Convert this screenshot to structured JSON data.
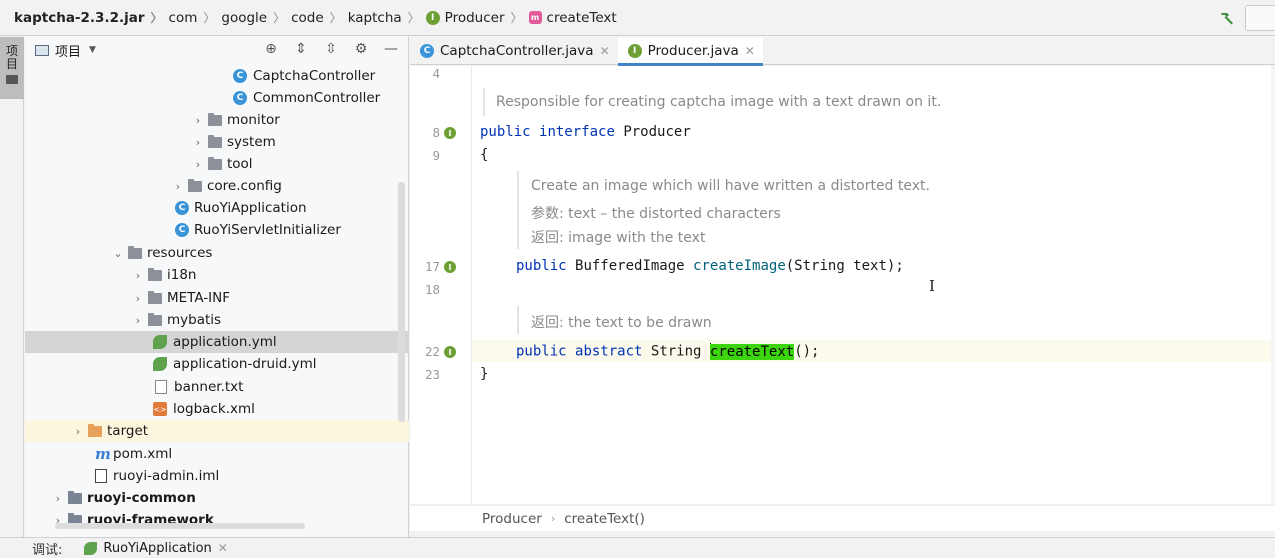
{
  "navbar": {
    "crumbs": [
      "kaptcha-2.3.2.jar",
      "com",
      "google",
      "code",
      "kaptcha",
      "Producer",
      "createText"
    ],
    "interface_badge": "I",
    "method_badge": "m"
  },
  "sidebar": {
    "project_tab_label": "项目"
  },
  "project": {
    "title": "项目",
    "tree": [
      {
        "label": "CaptchaController",
        "type": "class-icon"
      },
      {
        "label": "CommonController",
        "type": "class-icon"
      },
      {
        "label": "monitor",
        "type": "folder-icon"
      },
      {
        "label": "system",
        "type": "folder-icon"
      },
      {
        "label": "tool",
        "type": "folder-icon"
      },
      {
        "label": "core.config",
        "type": "folder-icon"
      },
      {
        "label": "RuoYiApplication",
        "type": "spring-class-icon"
      },
      {
        "label": "RuoYiServletInitializer",
        "type": "class-icon"
      },
      {
        "label": "resources",
        "type": "resources-folder-icon"
      },
      {
        "label": "i18n",
        "type": "folder-icon"
      },
      {
        "label": "META-INF",
        "type": "folder-icon"
      },
      {
        "label": "mybatis",
        "type": "folder-icon"
      },
      {
        "label": "application.yml",
        "type": "spring-leaf-icon"
      },
      {
        "label": "application-druid.yml",
        "type": "spring-leaf-icon"
      },
      {
        "label": "banner.txt",
        "type": "text-file-icon"
      },
      {
        "label": "logback.xml",
        "type": "xml-file-icon"
      },
      {
        "label": "target",
        "type": "excluded-folder-icon"
      },
      {
        "label": "pom.xml",
        "type": "maven-icon"
      },
      {
        "label": "ruoyi-admin.iml",
        "type": "iml-file-icon"
      },
      {
        "label": "ruoyi-common",
        "type": "module-folder-icon"
      },
      {
        "label": "ruoyi-framework",
        "type": "module-folder-icon"
      }
    ]
  },
  "tabs": [
    {
      "label": "CaptchaController.java",
      "badge": "C",
      "active": false
    },
    {
      "label": "Producer.java",
      "badge": "I",
      "active": true
    }
  ],
  "editor": {
    "line_numbers": [
      "4",
      "8",
      "9",
      "17",
      "18",
      "22",
      "23"
    ],
    "doc1": "Responsible for creating captcha image with a text drawn on it.",
    "line8_kw1": "public",
    "line8_kw2": "interface",
    "line8_name": "Producer",
    "line9": "{",
    "doc2_line1": "Create an image which will have written a distorted text.",
    "doc2_param_label": "参数:",
    "doc2_param_text": "text – the distorted characters",
    "doc2_return_label": "返回:",
    "doc2_return_text": "image with the text",
    "line17_kw": "public",
    "line17_type": "BufferedImage",
    "line17_method": "createImage",
    "line17_args": "(String text);",
    "doc3_return_label": "返回:",
    "doc3_return_text": "the text to be drawn",
    "line22_kw1": "public",
    "line22_kw2": "abstract",
    "line22_type": "String",
    "line22_method": "createText",
    "line22_args": "();",
    "line23": "}"
  },
  "breadcrumb": {
    "items": [
      "Producer",
      "createText()"
    ]
  },
  "bottombar": {
    "debug_label": "调试:",
    "run_config": "RuoYiApplication"
  },
  "colors": {
    "keyword": "#0033b3",
    "method": "#00627a",
    "highlight": "#3bd40f",
    "active_tab_underline": "#4083c9",
    "selected_row": "#d5d5d5"
  }
}
